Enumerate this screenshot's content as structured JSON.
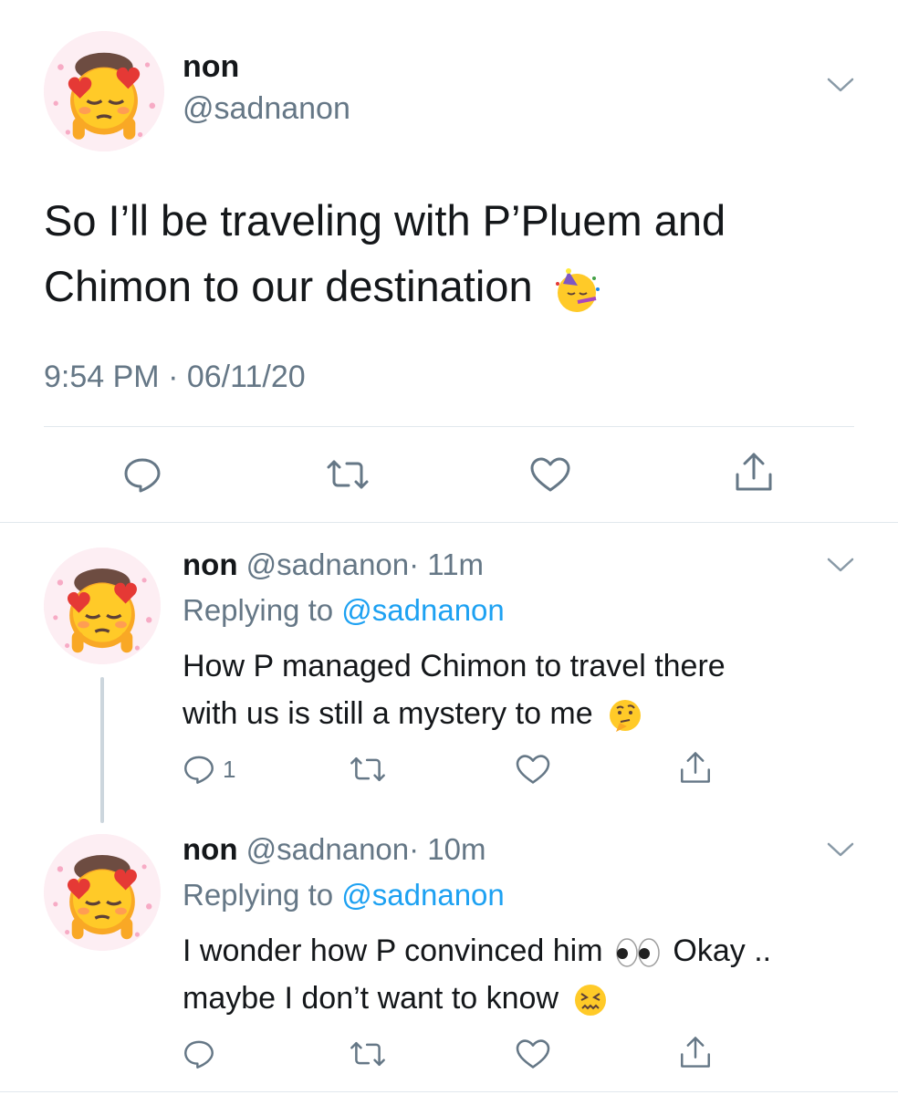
{
  "main_tweet": {
    "name": "non",
    "handle": "@sadnanon",
    "text": "So I’ll be traveling with P’Pluem and Chimon to our destination",
    "text_line1": "So I’ll be traveling with P’Pluem and",
    "text_line2": "Chimon to our destination",
    "emoji": "partying-face-icon",
    "timestamp": "9:54 PM · 06/11/20"
  },
  "replies": [
    {
      "name": "non",
      "handle": "@sadnanon",
      "time": "· 11m",
      "replying_prefix": "Replying to",
      "replying_to": "@sadnanon",
      "text_line1": "How P managed Chimon to travel there",
      "text_line2": "with us is still a mystery to me",
      "emoji": "thinking-face-icon",
      "reply_count": "1"
    },
    {
      "name": "non",
      "handle": "@sadnanon",
      "time": "· 10m",
      "replying_prefix": "Replying to",
      "replying_to": "@sadnanon",
      "text_line1a": "I wonder how P convinced him",
      "text_line1b": "Okay ..",
      "text_line2": "maybe I don’t want to know",
      "emoji1": "eyes-icon",
      "emoji2": "confounded-face-icon",
      "reply_count": ""
    }
  ],
  "colors": {
    "text": "#14171a",
    "secondary": "#657786",
    "link": "#1da1f2",
    "divider": "#e1e8ed"
  }
}
